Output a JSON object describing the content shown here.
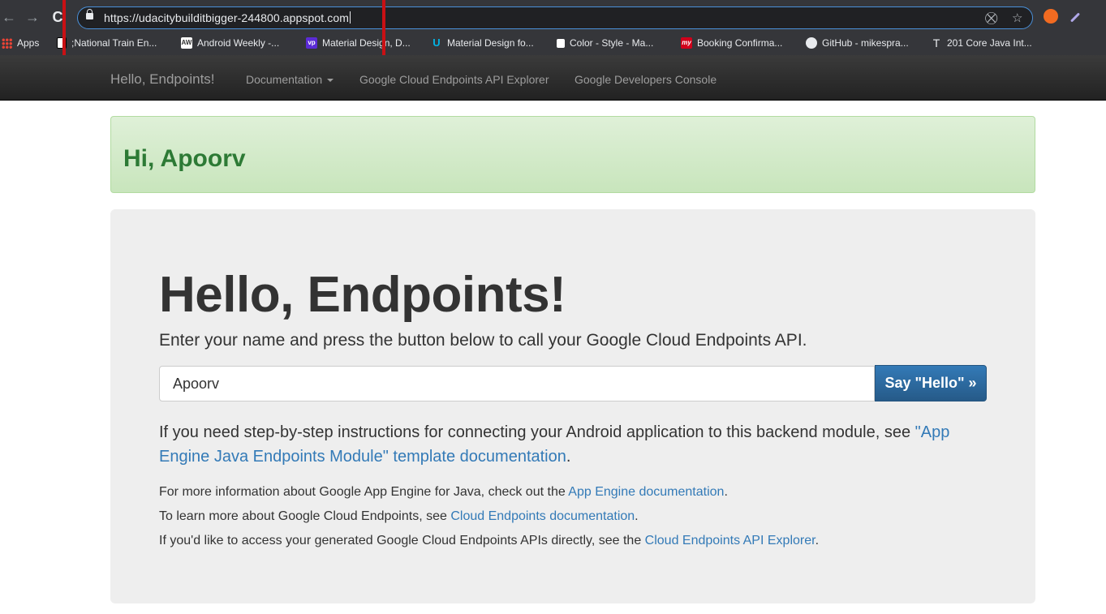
{
  "browser": {
    "url": "https://udacitybuilditbigger-244800.appspot.com",
    "nav": {
      "back": "←",
      "forward": "→",
      "reload": "C"
    },
    "bookmarks": [
      {
        "label": "Apps",
        "icon": "apps-grid-icon"
      },
      {
        "label": ";National Train En...",
        "icon": "page-icon"
      },
      {
        "label": "Android Weekly -...",
        "icon": "aw-icon",
        "icon_text": "AW"
      },
      {
        "label": "Material Design, D...",
        "icon": "vp-icon",
        "icon_text": "vp"
      },
      {
        "label": "Material Design fo...",
        "icon": "udacity-icon",
        "icon_text": "U"
      },
      {
        "label": "Color - Style - Ma...",
        "icon": "page-icon"
      },
      {
        "label": "Booking Confirma...",
        "icon": "my-icon",
        "icon_text": "my"
      },
      {
        "label": "GitHub - mikespra...",
        "icon": "github-icon"
      },
      {
        "label": "201 Core Java Int...",
        "icon": "t-icon",
        "icon_text": "T"
      }
    ],
    "colors": {
      "highlight": "#c91014",
      "omnibox_border": "#4a90d9"
    }
  },
  "navbar": {
    "brand": "Hello, Endpoints!",
    "links": [
      "Documentation",
      "Google Cloud Endpoints API Explorer",
      "Google Developers Console"
    ]
  },
  "alert": {
    "text": "Hi, Apoorv"
  },
  "jumbotron": {
    "title": "Hello, Endpoints!",
    "lead": "Enter your name and press the button below to call your Google Cloud Endpoints API.",
    "input_value": "Apoorv",
    "button_label": "Say \"Hello\" »",
    "para_text": "If you need step-by-step instructions for connecting your Android application to this backend module, see ",
    "para_link": "\"App Engine Java Endpoints Module\" template documentation",
    "para_end": ".",
    "info": [
      {
        "text": "For more information about Google App Engine for Java, check out the ",
        "link": "App Engine documentation",
        "end": "."
      },
      {
        "text": "To learn more about Google Cloud Endpoints, see ",
        "link": "Cloud Endpoints documentation",
        "end": "."
      },
      {
        "text": "If you'd like to access your generated Google Cloud Endpoints APIs directly, see the ",
        "link": "Cloud Endpoints API Explorer",
        "end": "."
      }
    ]
  }
}
